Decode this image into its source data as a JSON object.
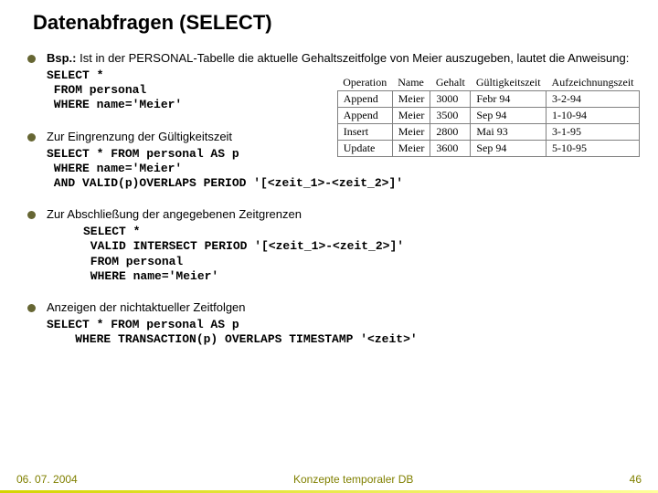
{
  "title": "Datenabfragen (SELECT)",
  "b1": {
    "intro_bold": "Bsp.:",
    "intro_rest": " Ist in der PERSONAL-Tabelle die aktuelle Gehaltszeitfolge von Meier auszugeben, lautet die Anweisung:",
    "code": "SELECT *\n FROM personal\n WHERE name='Meier'"
  },
  "b2": {
    "intro": "Zur Eingrenzung der Gültigkeitszeit",
    "code": "SELECT * FROM personal AS p\n WHERE name='Meier'\n AND VALID(p)OVERLAPS PERIOD '[<zeit_1>-<zeit_2>]'"
  },
  "b3": {
    "intro": "Zur Abschließung der angegebenen Zeitgrenzen",
    "code": "SELECT *\n VALID INTERSECT PERIOD '[<zeit_1>-<zeit_2>]'\n FROM personal\n WHERE name='Meier'"
  },
  "b4": {
    "intro": "Anzeigen der nichtaktueller Zeitfolgen",
    "code": "SELECT * FROM personal AS p\n    WHERE TRANSACTION(p) OVERLAPS TIMESTAMP '<zeit>'"
  },
  "table": {
    "headers": [
      "Operation",
      "Name",
      "Gehalt",
      "Gültigkeitszeit",
      "Aufzeichnungszeit"
    ],
    "rows": [
      [
        "Append",
        "Meier",
        "3000",
        "Febr 94",
        "3-2-94"
      ],
      [
        "Append",
        "Meier",
        "3500",
        "Sep 94",
        "1-10-94"
      ],
      [
        "Insert",
        "Meier",
        "2800",
        "Mai 93",
        "3-1-95"
      ],
      [
        "Update",
        "Meier",
        "3600",
        "Sep 94",
        "5-10-95"
      ]
    ]
  },
  "footer": {
    "date": "06. 07. 2004",
    "center": "Konzepte temporaler DB",
    "page": "46"
  }
}
